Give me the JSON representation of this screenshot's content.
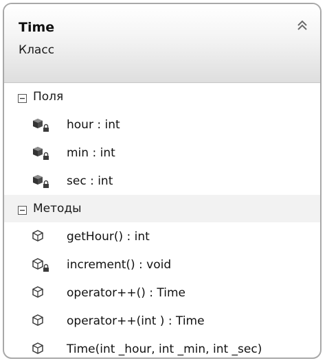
{
  "class": {
    "name": "Time",
    "kind": "Класс"
  },
  "sections": {
    "fields": {
      "label": "Поля",
      "items": [
        {
          "label": "hour : int",
          "icon": "private-field-icon"
        },
        {
          "label": "min : int",
          "icon": "private-field-icon"
        },
        {
          "label": "sec : int",
          "icon": "private-field-icon"
        }
      ]
    },
    "methods": {
      "label": "Методы",
      "items": [
        {
          "label": "getHour() : int",
          "icon": "public-method-icon"
        },
        {
          "label": "increment() : void",
          "icon": "private-method-icon"
        },
        {
          "label": "operator++() : Time",
          "icon": "public-method-icon"
        },
        {
          "label": "operator++(int ) : Time",
          "icon": "public-method-icon"
        },
        {
          "label": "Time(int _hour, int _min, int _sec)",
          "icon": "public-method-icon"
        }
      ]
    }
  },
  "colors": {
    "border": "#a8a8a8",
    "field_icon": "#4a4a4a",
    "method_icon": "#3c3c3c"
  }
}
